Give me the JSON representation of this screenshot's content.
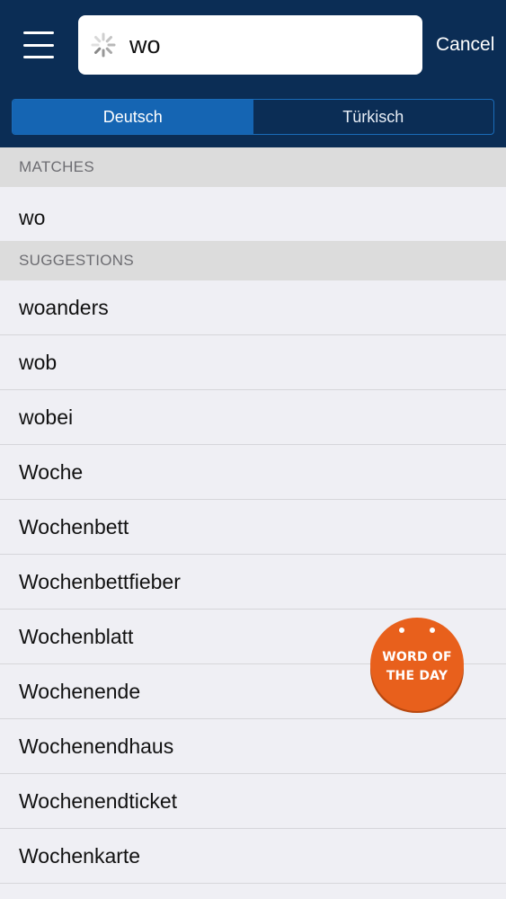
{
  "header": {
    "search_value": "wo",
    "cancel_label": "Cancel"
  },
  "tabs": [
    {
      "label": "Deutsch",
      "active": true
    },
    {
      "label": "Türkisch",
      "active": false
    }
  ],
  "sections": {
    "matches_title": "MATCHES",
    "matches": [
      "wo"
    ],
    "suggestions_title": "SUGGESTIONS",
    "suggestions": [
      "woanders",
      "wob",
      "wobei",
      "Woche",
      "Wochenbett",
      "Wochenbettfieber",
      "Wochenblatt",
      "Wochenende",
      "Wochenendhaus",
      "Wochenendticket",
      "Wochenkarte"
    ]
  },
  "word_of_the_day": {
    "line1": "WORD OF",
    "line2": "THE DAY"
  },
  "colors": {
    "header_bg": "#0b2d55",
    "segment_active": "#1565b3",
    "badge_orange": "#e8601c"
  }
}
